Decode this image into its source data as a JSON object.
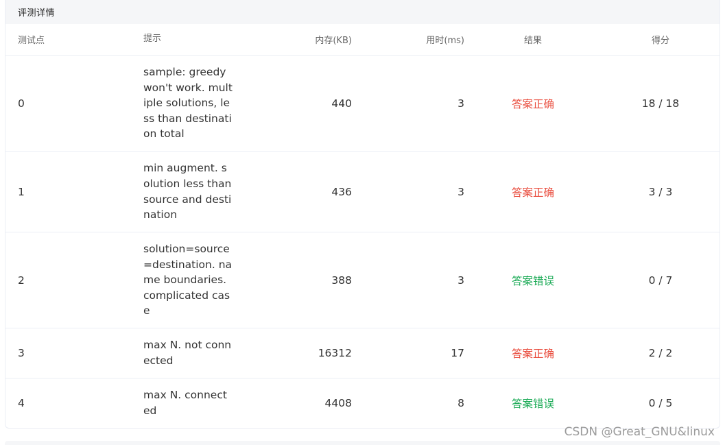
{
  "panel": {
    "title": "评测详情"
  },
  "columns": {
    "id": "测试点",
    "hint": "提示",
    "memory": "内存(KB)",
    "time": "用时(ms)",
    "result": "结果",
    "score": "得分"
  },
  "rows": [
    {
      "id": "0",
      "hint": "sample: greedy won't work. multiple solutions, less than destination total",
      "memory": "440",
      "time": "3",
      "result": "答案正确",
      "score": "18 / 18"
    },
    {
      "id": "1",
      "hint": "min augment. solution less than source and destination",
      "memory": "436",
      "time": "3",
      "result": "答案正确",
      "score": "3 / 3"
    },
    {
      "id": "2",
      "hint": "solution=source=destination. name boundaries. complicated case",
      "memory": "388",
      "time": "3",
      "result": "答案错误",
      "score": "0 / 7"
    },
    {
      "id": "3",
      "hint": "max N. not connected",
      "memory": "16312",
      "time": "17",
      "result": "答案正确",
      "score": "2 / 2"
    },
    {
      "id": "4",
      "hint": "max N. connected",
      "memory": "4408",
      "time": "8",
      "result": "答案错误",
      "score": "0 / 5"
    }
  ],
  "colors": {
    "accepted": "#e94b3c",
    "wrong": "#1aaa55",
    "header_bg": "#f5f6f8"
  },
  "watermark": "CSDN @Great_GNU&linux"
}
